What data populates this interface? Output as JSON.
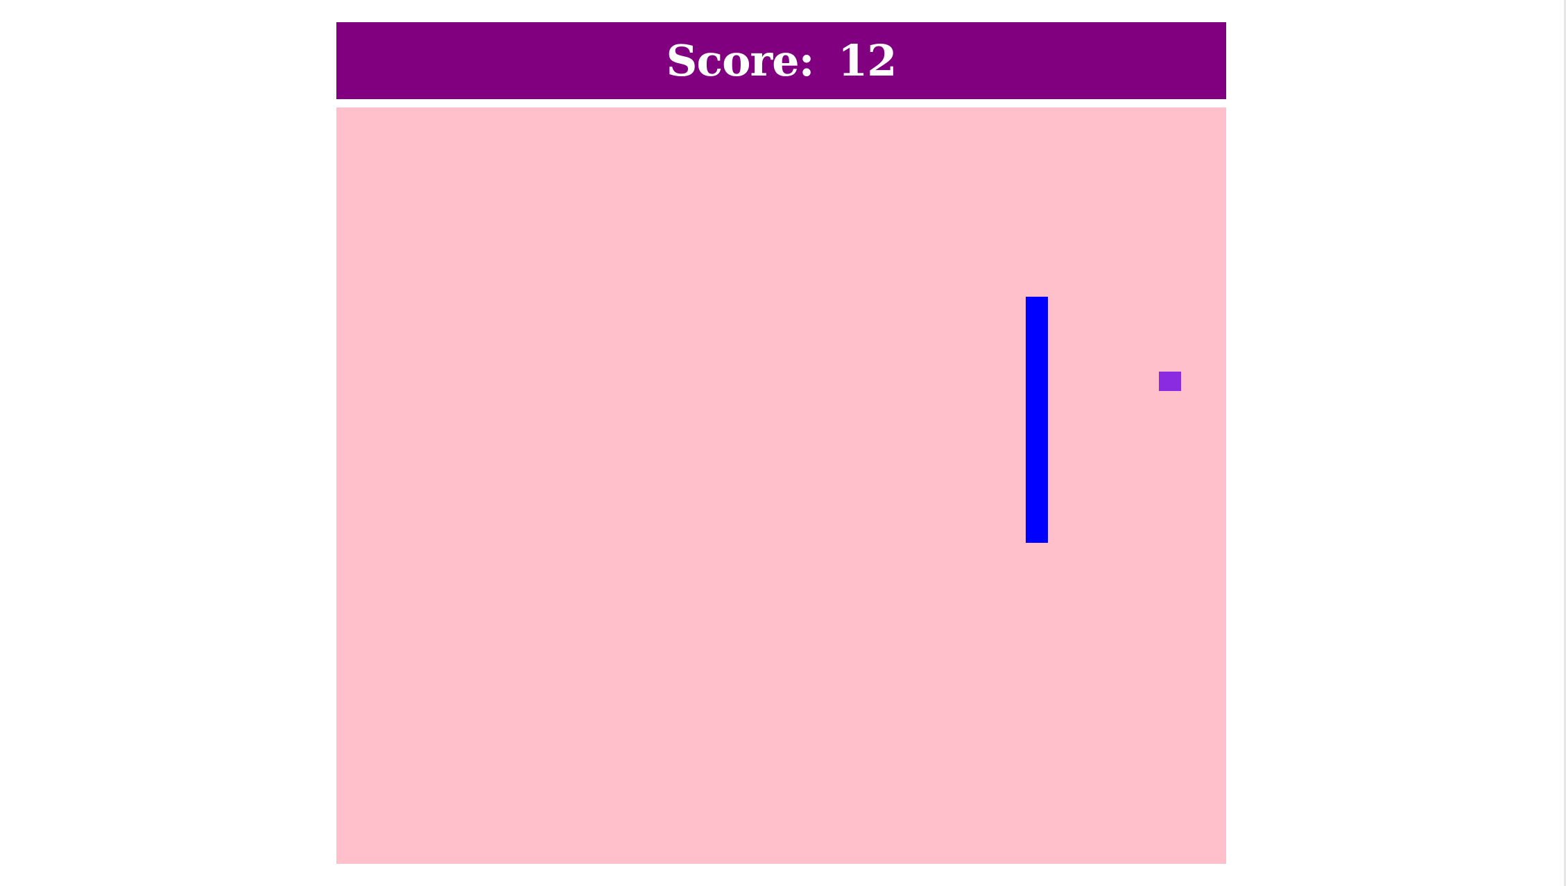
{
  "header": {
    "score_label": "Score:",
    "score_value": "12"
  },
  "colors": {
    "header_background": "#800080",
    "header_text": "#ffffff",
    "board_background": "#ffc0cb",
    "paddle": "#0000ff",
    "ball": "#8a2be2",
    "page_background": "#ffffff"
  },
  "icons": {
    "paddle": "rectangle-paddle",
    "ball": "square-ball"
  }
}
